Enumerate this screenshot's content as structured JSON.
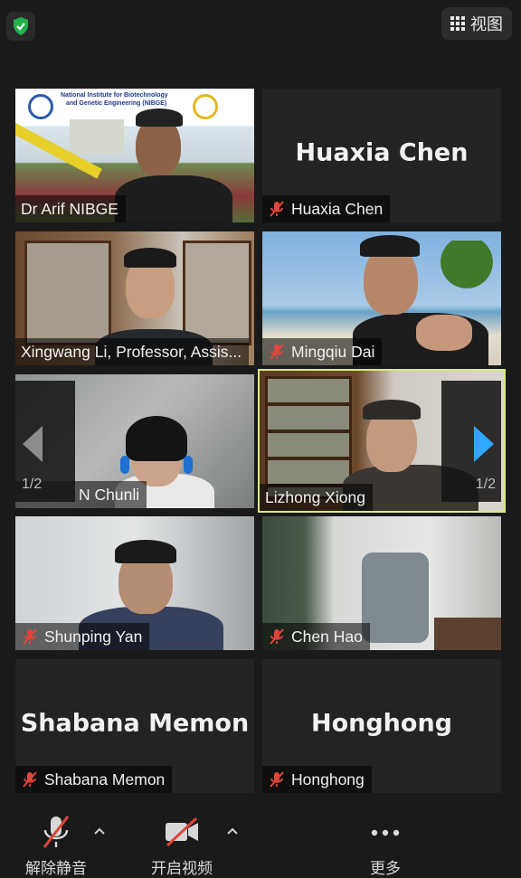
{
  "top_bar": {
    "view_label": "视图"
  },
  "participants": [
    {
      "name": "Dr Arif NIBGE",
      "muted": false,
      "video": true,
      "banner_line1": "National Institute for Biotechnology",
      "banner_line2": "and Genetic Engineering (NIBGE)"
    },
    {
      "name": "Huaxia Chen",
      "muted": true,
      "video": false
    },
    {
      "name": "Xingwang Li, Professor, Assis...",
      "muted": false,
      "video": true
    },
    {
      "name": "Mingqiu Dai",
      "muted": true,
      "video": true
    },
    {
      "name": "N Chunli",
      "muted": false,
      "video": true
    },
    {
      "name": "Lizhong Xiong",
      "muted": false,
      "video": true,
      "active_speaker": true
    },
    {
      "name": "Shunping Yan",
      "muted": true,
      "video": true
    },
    {
      "name": "Chen Hao",
      "muted": true,
      "video": true
    },
    {
      "name": "Shabana Memon",
      "muted": true,
      "video": false
    },
    {
      "name": "Honghong",
      "muted": true,
      "video": false
    }
  ],
  "pager": {
    "left": "1/2",
    "right": "1/2"
  },
  "toolbar": {
    "unmute": "解除静音",
    "start_video": "开启视频",
    "more": "更多"
  },
  "colors": {
    "active_border": "#d9ec7c",
    "mute_red": "#e0453a",
    "next_arrow": "#2ea7ff",
    "shield_green": "#22b14c"
  }
}
